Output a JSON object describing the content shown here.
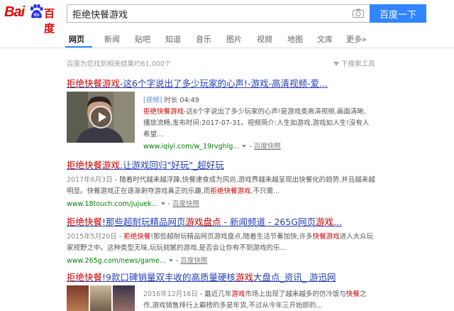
{
  "logo": {
    "latin": "Bai",
    "chinese": "百度",
    "paw_text": "du"
  },
  "search": {
    "query": "拒绝快餐游戏",
    "button": "百度一下"
  },
  "tabs": [
    {
      "label": "网页",
      "active": true
    },
    {
      "label": "新闻"
    },
    {
      "label": "贴吧"
    },
    {
      "label": "知道"
    },
    {
      "label": "音乐"
    },
    {
      "label": "图片"
    },
    {
      "label": "视频"
    },
    {
      "label": "地图"
    },
    {
      "label": "文库"
    },
    {
      "label": "更多»"
    }
  ],
  "stats": "百度为您找到相关结果约61,000个",
  "tools": "下搜索工具",
  "results": [
    {
      "title_a": "拒绝快餐游戏",
      "title_b": "-这6个字说出了多少玩家的心声!-游戏-高清视频-爱...",
      "video_tag": "[视频]",
      "duration": "时长 04:49",
      "abs_em": "拒绝快餐游戏",
      "abs_rest": "-这6个字说出了多少玩家的心声!是游戏类高清视频,画面清晰,播放流畅,发布时间:2017-07-31。视频简介:人生如游戏,游戏如人生!没有人希望...",
      "url": "www.iqiyi.com/w_19rvghlg...",
      "snapshot": "百度快照"
    },
    {
      "title_a": "拒绝快餐游戏",
      "title_b": ",让游戏回归\"好玩\"_超好玩",
      "date": "2017年6月3日",
      "abs_pre": " - 随着时代越来越浮躁,快餐速食成为风尚,游戏界越来越呈现出快餐化的趋势,并且越来越明显。快餐游戏正在逐渐剥夺游戏真正的乐趣,而",
      "abs_em": "拒绝快餐游戏",
      "abs_post": ",不只需...",
      "url": "www.18touch.com/jujuek...",
      "snapshot": "百度快照"
    },
    {
      "title_a": "拒绝快餐",
      "title_b": "!那些超耐玩精品网页",
      "title_c": "游戏盘点",
      "title_d": " - 新闻频道 - 265G网页",
      "title_e": "游戏",
      "title_f": "...",
      "date": "2015年5月20日",
      "abs_pre": " - ",
      "abs_em": "拒绝快餐",
      "abs_mid": "!那些超耐玩精品网页游戏盘点,随着生活节奏加快,许多",
      "abs_em2": "快餐游戏",
      "abs_post": "进入大众玩家视野之中。这种类型无味,玩玩就腻的游戏,是否会让你有不到游戏的乐...",
      "url": "www.265g.com/news/game...",
      "snapshot": "百度快照"
    },
    {
      "title_a": "拒绝快餐",
      "title_b": "!9款口碑销量双丰收的高质量硬核",
      "title_c": "游戏",
      "title_d": "大盘点_资讯_ 游迅网",
      "date": "2016年12月16日",
      "abs_pre": " - 最近几年",
      "abs_em": "游戏",
      "abs_mid": "市场上出现了越来越多的仿冷饭与",
      "abs_em2": "快餐",
      "abs_post": "之作,游戏销售排行上霸榜的多是年货,不过从今年三开始即的..."
    }
  ],
  "colors": {
    "link": "#2440b3",
    "highlight": "#c00000",
    "url": "#008000",
    "button": "#3385ff",
    "brand": "#e10602"
  },
  "icons": [
    "camera-icon",
    "play-icon",
    "paw-icon"
  ]
}
